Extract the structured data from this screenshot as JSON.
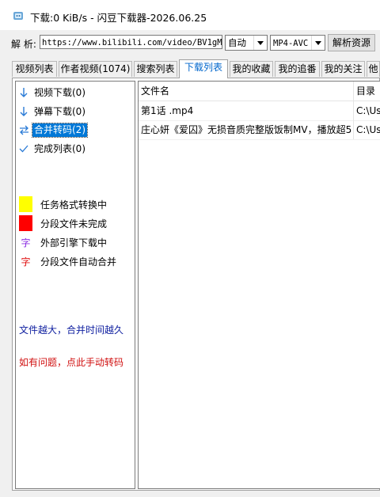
{
  "window": {
    "title": "下载:0 KiB/s - 闪豆下载器-2026.06.25"
  },
  "url_bar": {
    "label": "解 析:",
    "value": "https://www.bilibili.com/video/BV1gM4",
    "quality": "自动",
    "format": "MP4-AVC",
    "parse_button": "解析资源"
  },
  "tabs": [
    {
      "label": "视频列表"
    },
    {
      "label": "作者视频(1074)"
    },
    {
      "label": "搜索列表"
    },
    {
      "label": "下载列表",
      "active": true
    },
    {
      "label": "我的收藏"
    },
    {
      "label": "我的追番"
    },
    {
      "label": "我的关注"
    },
    {
      "label": "他"
    }
  ],
  "sidebar": {
    "items": [
      {
        "label": "视频下载(0)",
        "icon": "arrow-down-icon"
      },
      {
        "label": "弹幕下载(0)",
        "icon": "arrow-down-icon"
      },
      {
        "label": "合并转码(2)",
        "icon": "swap-arrows-icon",
        "selected": true
      },
      {
        "label": "完成列表(0)",
        "icon": "checkmark-icon"
      }
    ],
    "legend": [
      {
        "label": "任务格式转换中",
        "color": "#ffff00"
      },
      {
        "label": "分段文件未完成",
        "color": "#ff0000"
      },
      {
        "label": "外部引擎下载中",
        "glyph": "字",
        "color": "#8a2be2"
      },
      {
        "label": "分段文件自动合并",
        "glyph": "字",
        "color": "#e01010"
      }
    ],
    "note_size": "文件越大，合并时间越久",
    "note_size_color": "#1020a0",
    "note_help": "如有问题，点此手动转码",
    "note_help_color": "#d01010"
  },
  "table": {
    "columns": [
      "文件名",
      "目录"
    ],
    "rows": [
      {
        "name": "第1话 .mp4",
        "dir": "C:\\Us"
      },
      {
        "name": "庄心妍《爱囚》无损音质完整版饭制MV，播放超5",
        "dir": "C:\\Us"
      }
    ]
  }
}
